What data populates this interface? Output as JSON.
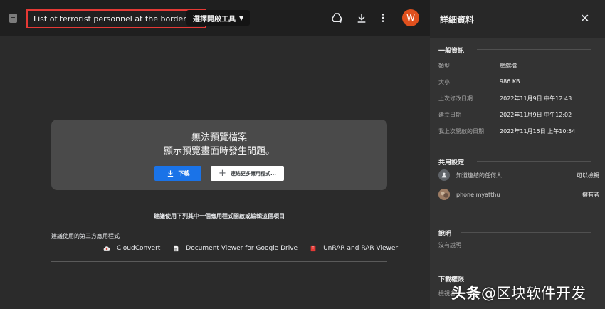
{
  "viewer": {
    "file_name": "List of terrorist personnel at the border.rar",
    "open_with_label": "選擇開啟工具",
    "avatar_initial": "W",
    "error_title": "無法預覽檔案",
    "error_message": "顯示預覽畫面時發生問題。",
    "download_label": "下載",
    "connect_label": "連結更多應用程式...",
    "suggest_title": "建議使用下列其中一個應用程式開啟或編輯這個項目",
    "third_party_label": "建議使用的第三方應用程式",
    "apps": [
      {
        "name": "CloudConvert",
        "icon": "cloud-icon"
      },
      {
        "name": "Document Viewer for Google Drive",
        "icon": "document-icon"
      },
      {
        "name": "UnRAR and RAR Viewer",
        "icon": "archive-icon"
      }
    ]
  },
  "panel": {
    "title": "詳細資料",
    "general": {
      "title": "一般資訊",
      "rows": [
        {
          "label": "類型",
          "value": "壓縮檔"
        },
        {
          "label": "大小",
          "value": "986 KB"
        },
        {
          "label": "上次修改日期",
          "value": "2022年11月9日 中午12:43"
        },
        {
          "label": "建立日期",
          "value": "2022年11月9日 中午12:02"
        },
        {
          "label": "我上次開啟的日期",
          "value": "2022年11月15日 上午10:54"
        }
      ]
    },
    "sharing": {
      "title": "共用設定",
      "rows": [
        {
          "name": "知道連結的任何人",
          "role": "可以檢視"
        },
        {
          "name": "phone myatthu",
          "role": "擁有者"
        }
      ]
    },
    "description": {
      "title": "說明",
      "text": "沒有說明"
    },
    "download": {
      "title": "下載權限",
      "text": "檢視者"
    }
  },
  "watermark": {
    "brand": "头条",
    "handle": "@区块软件开发"
  },
  "colors": {
    "accent": "#1a73e8",
    "avatar": "#e0501d",
    "highlight": "#e53935"
  }
}
